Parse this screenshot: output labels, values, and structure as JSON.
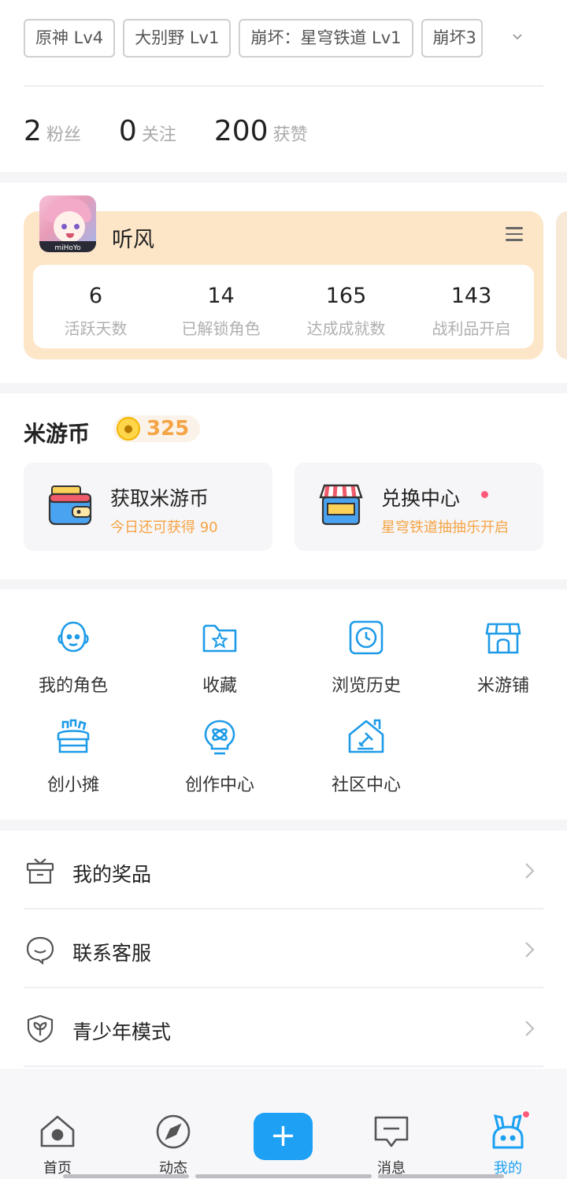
{
  "game_tags": [
    "原神 Lv4",
    "大别野 Lv1",
    "崩坏：星穹铁道 Lv1",
    "崩坏3"
  ],
  "tags_more_icon": "chevron-down-icon",
  "stats": [
    {
      "num": "2",
      "label": "粉丝"
    },
    {
      "num": "0",
      "label": "关注"
    },
    {
      "num": "200",
      "label": "获赞"
    }
  ],
  "game_card": {
    "name": "听风",
    "avatar_text": "miHoYo",
    "stats": [
      {
        "num": "6",
        "label": "活跃天数"
      },
      {
        "num": "14",
        "label": "已解锁角色"
      },
      {
        "num": "165",
        "label": "达成成就数"
      },
      {
        "num": "143",
        "label": "战利品开启"
      }
    ]
  },
  "coins": {
    "title": "米游币",
    "value": "325",
    "earn": {
      "title": "获取米游币",
      "sub": "今日还可获得 90"
    },
    "exchange": {
      "title": "兑换中心",
      "sub": "星穹铁道抽抽乐开启"
    }
  },
  "grid": [
    {
      "label": "我的角色",
      "icon": "character-icon"
    },
    {
      "label": "收藏",
      "icon": "favorites-folder-icon"
    },
    {
      "label": "浏览历史",
      "icon": "history-clock-icon"
    },
    {
      "label": "米游铺",
      "icon": "store-icon"
    },
    {
      "label": "创小摊",
      "icon": "stall-icon"
    },
    {
      "label": "创作中心",
      "icon": "creation-bulb-icon"
    },
    {
      "label": "社区中心",
      "icon": "community-house-icon"
    }
  ],
  "list": [
    {
      "label": "我的奖品",
      "icon": "gift-box-icon"
    },
    {
      "label": "联系客服",
      "icon": "customer-service-icon"
    },
    {
      "label": "青少年模式",
      "icon": "youth-shield-icon"
    }
  ],
  "nav": [
    {
      "label": "首页",
      "icon": "home-icon"
    },
    {
      "label": "动态",
      "icon": "compass-icon"
    },
    {
      "label": "",
      "icon": "plus-icon"
    },
    {
      "label": "消息",
      "icon": "message-icon"
    },
    {
      "label": "我的",
      "icon": "profile-bunny-icon"
    }
  ],
  "colors": {
    "accent": "#1ea0f5",
    "coin": "#f5a445",
    "card": "#fde6c8",
    "notify": "#ff5a7a"
  }
}
